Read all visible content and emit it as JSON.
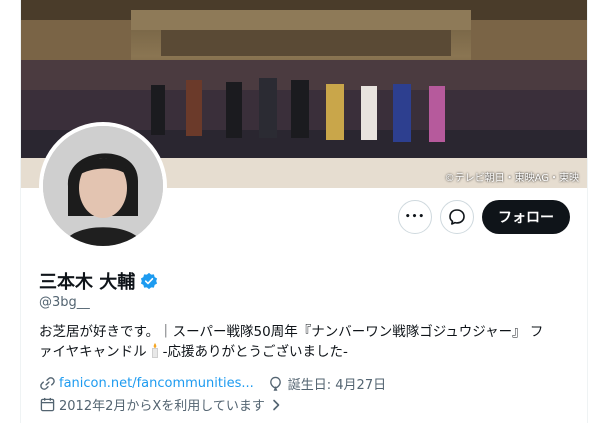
{
  "banner": {
    "credit": "©テレビ朝日・東映AG・東映"
  },
  "actions": {
    "more_label": "•••",
    "follow_label": "フォロー"
  },
  "profile": {
    "name": "三本木 大輔",
    "handle": "@3bg__",
    "bio_line1": "お芝居が好きです。｜スーパー戦隊50周年『ナンバーワン戦隊ゴジュウジャー』 フ",
    "bio_line2_a": "ァイヤキャンドル",
    "bio_line2_b": "-応援ありがとうございました-",
    "link": "fanicon.net/fancommunities...",
    "birthday": "誕生日: 4月27日",
    "joined": "2012年2月からXを利用しています"
  },
  "icons": [
    "more-icon",
    "message-icon",
    "verified-badge-icon",
    "link-icon",
    "birthday-icon",
    "calendar-icon",
    "chevron-right-icon",
    "candle-emoji-icon"
  ],
  "colors": {
    "accent": "#1d9bf0",
    "follow_bg": "#0f1419",
    "muted": "#536471"
  }
}
